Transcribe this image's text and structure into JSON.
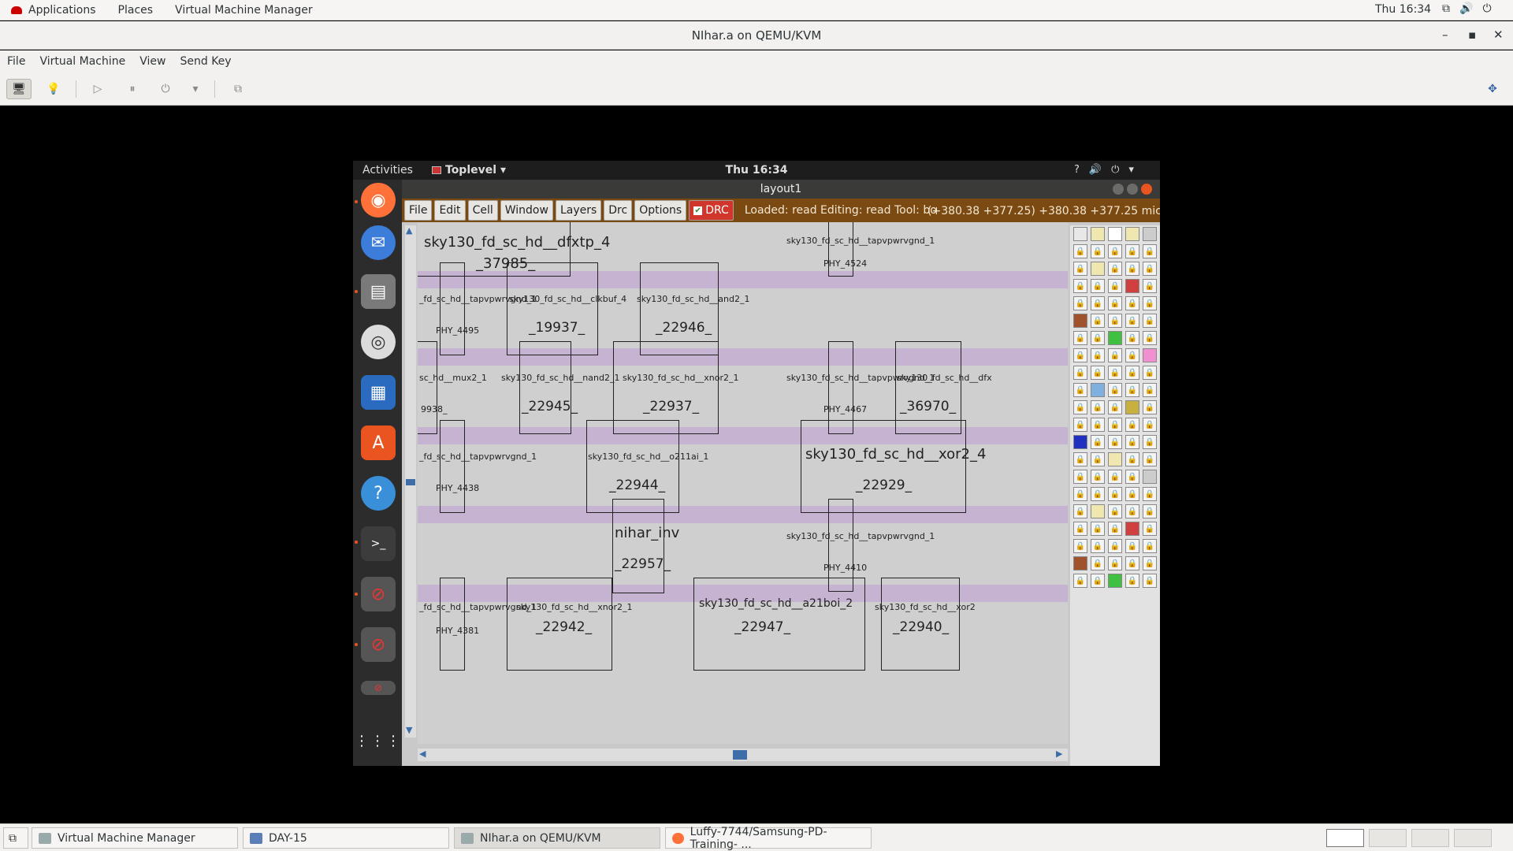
{
  "host_topbar": {
    "menus": [
      "Applications",
      "Places",
      "Virtual Machine Manager"
    ],
    "clock": "Thu 16:34",
    "tray_icons": [
      "network-icon",
      "volume-icon",
      "power-icon"
    ]
  },
  "vm_window": {
    "title": "NIhar.a on QEMU/KVM",
    "menus": [
      "File",
      "Virtual Machine",
      "View",
      "Send Key"
    ]
  },
  "guest": {
    "activities": "Activities",
    "app_menu": "Toplevel",
    "clock": "Thu 16:34",
    "layout_window": {
      "title": "layout1",
      "menu_buttons": [
        "File",
        "Edit",
        "Cell",
        "Window",
        "Layers",
        "Drc",
        "Options"
      ],
      "drc_label": "DRC",
      "status_text": "Loaded: read Editing: read Tool: bo",
      "coords": "(+380.38 +377.25) +380.38 +377.25 microns",
      "cells": [
        {
          "name": "sky130_fd_sc_hd__dfxtp_4",
          "inst": "_37985_"
        },
        {
          "name": "sky130_fd_sc_hd__tapvpwrvgnd_1",
          "inst": "PHY_4524"
        },
        {
          "name": "_fd_sc_hd__tapvpwrvgnd_1",
          "inst": "PHY_4495"
        },
        {
          "name": "sky130_fd_sc_hd__clkbuf_4",
          "inst": "_19937_"
        },
        {
          "name": "sky130_fd_sc_hd__and2_1",
          "inst": "_22946_"
        },
        {
          "name": "sc_hd__mux2_1",
          "inst": "9938_"
        },
        {
          "name": "sky130_fd_sc_hd__nand2_1",
          "inst": "_22945_"
        },
        {
          "name": "sky130_fd_sc_hd__xnor2_1",
          "inst": "_22937_"
        },
        {
          "name": "sky130_fd_sc_hd__tapvpwrvgnd_1",
          "inst": "PHY_4467"
        },
        {
          "name": "sky130_fd_sc_hd__dfx",
          "inst": "_36970_"
        },
        {
          "name": "_fd_sc_hd__tapvpwrvgnd_1",
          "inst": "PHY_4438"
        },
        {
          "name": "sky130_fd_sc_hd__o211ai_1",
          "inst": "_22944_"
        },
        {
          "name": "sky130_fd_sc_hd__xor2_4",
          "inst": "_22929_"
        },
        {
          "name": "nihar_inv",
          "inst": "_22957_"
        },
        {
          "name": "sky130_fd_sc_hd__tapvpwrvgnd_1",
          "inst": "PHY_4410"
        },
        {
          "name": "_fd_sc_hd__tapvpwrvgnd_1",
          "inst": "PHY_4381"
        },
        {
          "name": "sky130_fd_sc_hd__xnor2_1",
          "inst": "_22942_"
        },
        {
          "name": "sky130_fd_sc_hd__a21boi_2",
          "inst": "_22947_"
        },
        {
          "name": "sky130_fd_sc_hd__xor2",
          "inst": "_22940_"
        }
      ]
    }
  },
  "taskbar": {
    "tasks": [
      "Virtual Machine Manager",
      "DAY-15",
      "NIhar.a on QEMU/KVM",
      "Luffy-7744/Samsung-PD-Training- ..."
    ]
  }
}
